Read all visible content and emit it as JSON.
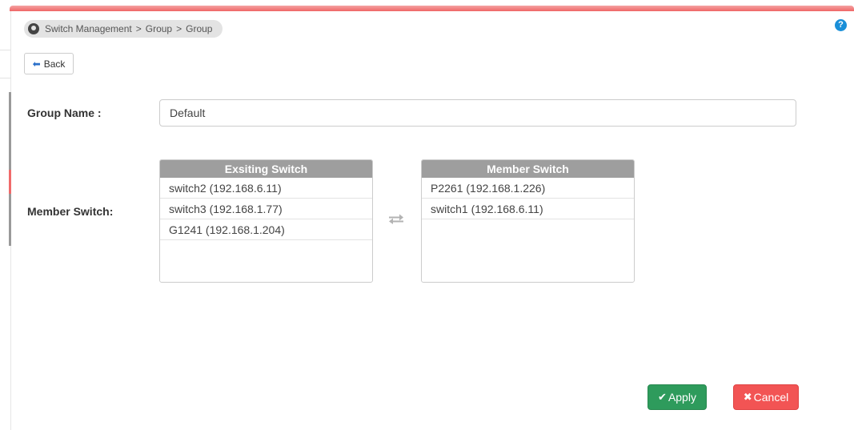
{
  "breadcrumb": {
    "items": [
      "Switch Management",
      "Group",
      "Group"
    ],
    "separator": ">"
  },
  "help": {
    "glyph": "?"
  },
  "back_button": {
    "label": "Back",
    "icon": "arrow-left-icon"
  },
  "form": {
    "group_name_label": "Group Name :",
    "group_name_value": "Default",
    "member_switch_label": "Member Switch:"
  },
  "existing_list": {
    "title": "Exsiting Switch",
    "items": [
      "switch2 (192.168.6.11)",
      "switch3 (192.168.1.77)",
      "G1241 (192.168.1.204)"
    ]
  },
  "member_list": {
    "title": "Member Switch",
    "items": [
      "P2261 (192.168.1.226)",
      "switch1 (192.168.6.11)"
    ]
  },
  "actions": {
    "apply_label": "Apply",
    "apply_glyph": "✔",
    "cancel_label": "Cancel",
    "cancel_glyph": "✖"
  },
  "colors": {
    "accent_bar": "#ef5d5d",
    "apply": "#2e9b5c",
    "cancel": "#f25454",
    "list_header": "#9e9e9e",
    "help": "#1a8fd8"
  }
}
